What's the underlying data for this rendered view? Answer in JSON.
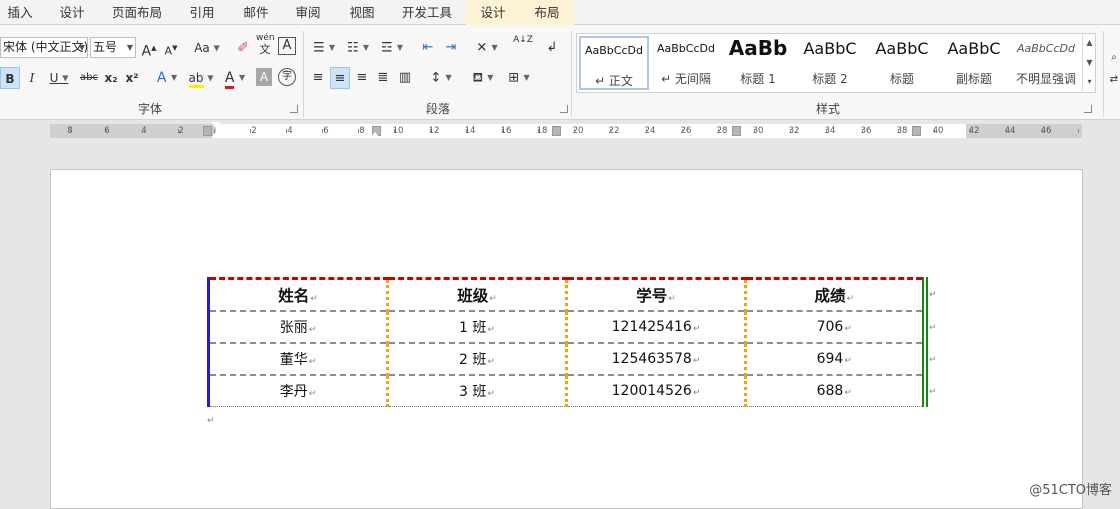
{
  "menu_tabs": [
    {
      "label": "插入"
    },
    {
      "label": "设计"
    },
    {
      "label": "页面布局"
    },
    {
      "label": "引用"
    },
    {
      "label": "邮件"
    },
    {
      "label": "审阅"
    },
    {
      "label": "视图"
    },
    {
      "label": "开发工具"
    },
    {
      "label": "设计"
    },
    {
      "label": "布局"
    }
  ],
  "ribbon": {
    "font": {
      "group_label": "字体",
      "font_name": "宋体 (中文正文)",
      "font_size": "五号",
      "grow_font": "A",
      "shrink_font": "A",
      "change_case": "Aa",
      "pinyin_top": "wén",
      "pinyin_bottom": "文",
      "border_char": "A",
      "bold": "B",
      "italic": "I",
      "underline": "U",
      "strikethrough": "abc",
      "subscript": "x₂",
      "superscript": "x²",
      "text_effects": "A",
      "highlight": "ab",
      "font_color": "A",
      "char_shading": "A",
      "enclose_char": "字"
    },
    "paragraph": {
      "group_label": "段落",
      "sort": "A↓Z"
    },
    "styles": {
      "group_label": "样式",
      "items": [
        {
          "sample": "AaBbCcDd",
          "name": "↵ 正文"
        },
        {
          "sample": "AaBbCcDd",
          "name": "↵ 无间隔"
        },
        {
          "sample": "AaBb",
          "name": "标题 1"
        },
        {
          "sample": "AaBbC",
          "name": "标题 2"
        },
        {
          "sample": "AaBbC",
          "name": "标题"
        },
        {
          "sample": "AaBbC",
          "name": "副标题"
        },
        {
          "sample": "AaBbCcDd",
          "name": "不明显强调"
        }
      ]
    }
  },
  "ruler": {
    "left_numbers": [
      "8",
      "6",
      "4",
      "2"
    ],
    "right_numbers": [
      "2",
      "4",
      "6",
      "8",
      "10",
      "12",
      "14",
      "16",
      "18",
      "20",
      "22",
      "24",
      "26",
      "28",
      "30",
      "32",
      "34",
      "36",
      "38",
      "40",
      "42",
      "44",
      "46"
    ]
  },
  "table": {
    "headers": [
      "姓名",
      "班级",
      "学号",
      "成绩"
    ],
    "rows": [
      [
        "张丽",
        "1 班",
        "121425416",
        "706"
      ],
      [
        "董华",
        "2 班",
        "125463578",
        "694"
      ],
      [
        "李丹",
        "3 班",
        "120014526",
        "688"
      ]
    ],
    "mark": "↵"
  },
  "watermark": "@51CTO博客",
  "colors": {
    "top_border": "#cc0000",
    "left_border": "#1f1fd0",
    "right_border": "#0f8a0f",
    "column_dividers": "#f0a500"
  }
}
